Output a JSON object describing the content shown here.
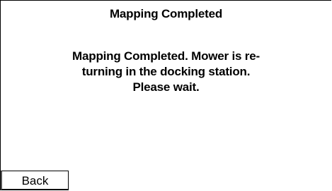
{
  "screen": {
    "title": "Mapping Completed",
    "message": "Mapping Completed. Mower is re-\nturning in the docking station.\nPlease wait.",
    "back_label": "Back"
  },
  "colors": {
    "background": "#ffffff",
    "text": "#000000",
    "border": "#000000"
  }
}
